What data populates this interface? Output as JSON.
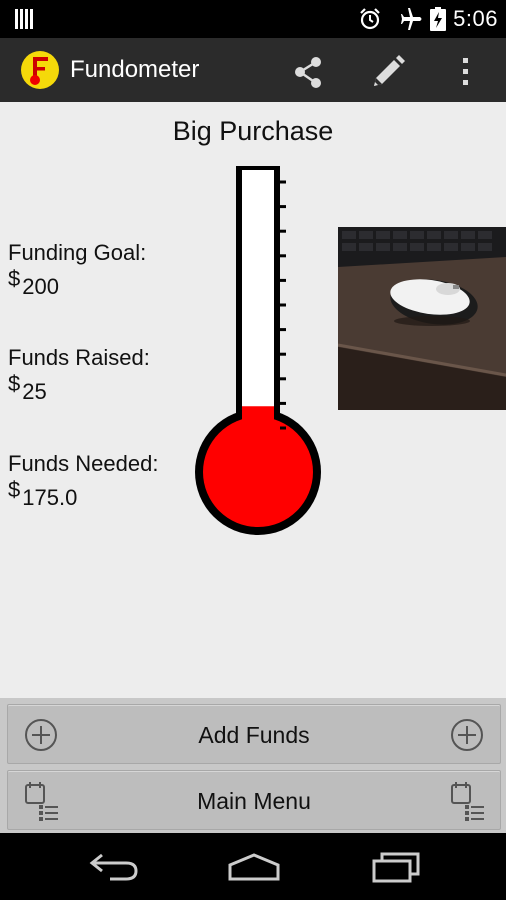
{
  "status": {
    "time": "5:06"
  },
  "app": {
    "title": "Fundometer"
  },
  "page": {
    "title": "Big Purchase",
    "currency_symbol": "$",
    "funding_goal_label": "Funding Goal:",
    "funding_goal_value": "200",
    "funds_raised_label": "Funds Raised:",
    "funds_raised_value": "25",
    "funds_needed_label": "Funds Needed:",
    "funds_needed_value": "175.0",
    "progress_fraction": 0.125
  },
  "buttons": {
    "add_funds": "Add Funds",
    "main_menu": "Main Menu"
  },
  "icons": {
    "action_bar": [
      "fundometer-logo-icon",
      "share-icon",
      "edit-pencil-icon",
      "overflow-menu-icon"
    ],
    "nav": [
      "back-icon",
      "home-icon",
      "recent-apps-icon"
    ]
  },
  "colors": {
    "mercury": "#ff0000",
    "action_bar": "#2b2b2b",
    "logo": "#f5d90a"
  }
}
